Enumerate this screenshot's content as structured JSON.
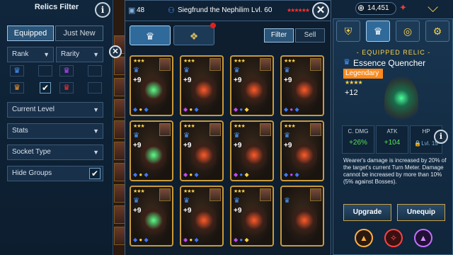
{
  "filter": {
    "title": "Relics Filter",
    "tabs": [
      {
        "label": "Equipped",
        "active": true
      },
      {
        "label": "Just New",
        "active": false
      }
    ],
    "rank_label": "Rank",
    "rarity_label": "Rarity",
    "dropdowns": [
      "Current Level",
      "Stats",
      "Socket Type"
    ],
    "hide_groups": "Hide Groups"
  },
  "top": {
    "count": "48",
    "champion": "Siegfrund the Nephilim Lvl. 60",
    "filter": "Filter",
    "sell": "Sell"
  },
  "currency": "14,451",
  "cards": [
    {
      "plus": "+9",
      "stars": "★★★"
    },
    {
      "plus": "+9",
      "stars": "★★★"
    },
    {
      "plus": "+9",
      "stars": "★★★"
    },
    {
      "plus": "+9",
      "stars": "★★★"
    },
    {
      "plus": "+9",
      "stars": "★★★"
    },
    {
      "plus": "+9",
      "stars": "★★★"
    },
    {
      "plus": "+9",
      "stars": "★★★"
    },
    {
      "plus": "+9",
      "stars": "★★★"
    },
    {
      "plus": "+9",
      "stars": "★★★"
    },
    {
      "plus": "+9",
      "stars": "★★★"
    },
    {
      "plus": "+9",
      "stars": "★★★"
    },
    {
      "plus": "",
      "stars": ""
    }
  ],
  "relic": {
    "section": "EQUIPPED RELIC",
    "name": "Essence Quencher",
    "rarity": "Legendary",
    "stars": "★★★★",
    "plus": "+12",
    "stats": [
      {
        "name": "C. DMG",
        "value": "+26%"
      },
      {
        "name": "ATK",
        "value": "+104"
      },
      {
        "name": "HP",
        "value": "Lvl. 15"
      }
    ],
    "desc": "Wearer's damage is increased by 20% of the target's current Turn Meter. Damage cannot be increased by more than 10% (5% against Bosses).",
    "upgrade": "Upgrade",
    "unequip": "Unequip"
  },
  "colors": {
    "accent": "#c89a3a",
    "legendary": "#ff8a1a",
    "green": "#58e058",
    "gold": "#ffd24a"
  }
}
